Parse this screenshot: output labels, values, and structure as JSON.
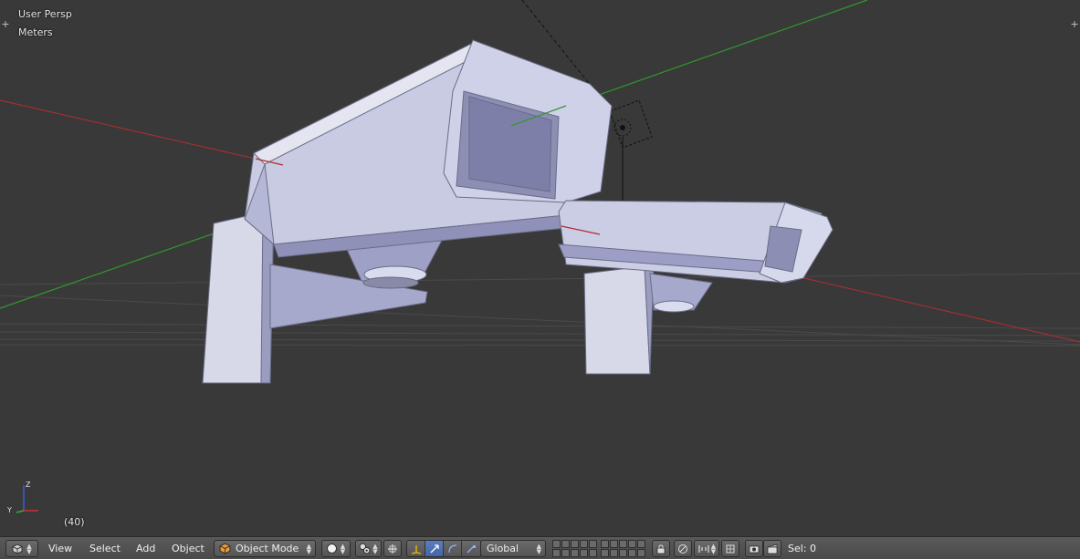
{
  "viewport": {
    "view_label": "User Persp",
    "units_label": "Meters",
    "frame_label": "(40)",
    "corner_plus_left": "+",
    "corner_plus_right": "+",
    "gizmo": {
      "x_label": "Y",
      "z_label": "Z"
    }
  },
  "header": {
    "editor_type_icon": "cube-icon",
    "menus": {
      "view": "View",
      "select": "Select",
      "add": "Add",
      "object": "Object"
    },
    "mode": {
      "label": "Object Mode",
      "icon": "object-cube-icon"
    },
    "shading_icon": "sphere-shading-icon",
    "pivot_icon": "pivot-icon",
    "manipulator_icons": [
      "manipulator-toggle-icon",
      "translate-icon",
      "rotate-icon",
      "scale-icon"
    ],
    "transform_orientation": "Global",
    "sel_label": "Sel: 0"
  },
  "colors": {
    "viewport_bg": "#393939",
    "header_bg": "#505050",
    "x_axis": "#b02a2a",
    "y_axis": "#2a9a2a",
    "model": "#b9bbd6",
    "active_button": "#4e74b8"
  }
}
